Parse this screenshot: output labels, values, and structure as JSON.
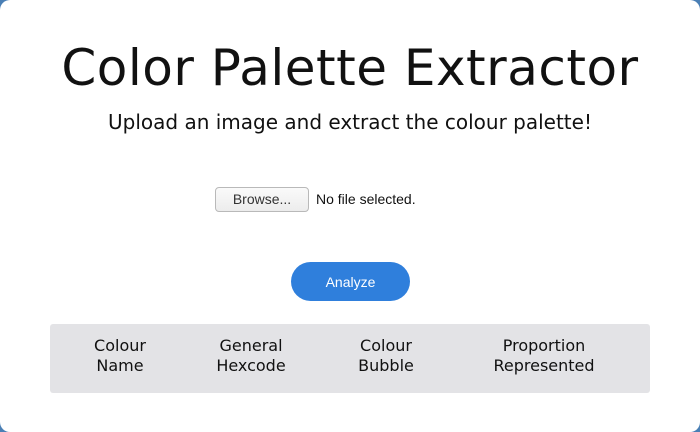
{
  "header": {
    "title": "Color Palette Extractor",
    "subtitle": "Upload an image and extract the colour palette!"
  },
  "upload": {
    "browse_label": "Browse...",
    "file_status": "No file selected."
  },
  "actions": {
    "analyze_label": "Analyze"
  },
  "table": {
    "columns": [
      "Colour\nName",
      "General\nHexcode",
      "Colour\nBubble",
      "Proportion\nRepresented"
    ]
  },
  "colors": {
    "accent": "#2f7fdc",
    "table_header_bg": "#e3e3e6",
    "background": "#4a7fb5"
  }
}
